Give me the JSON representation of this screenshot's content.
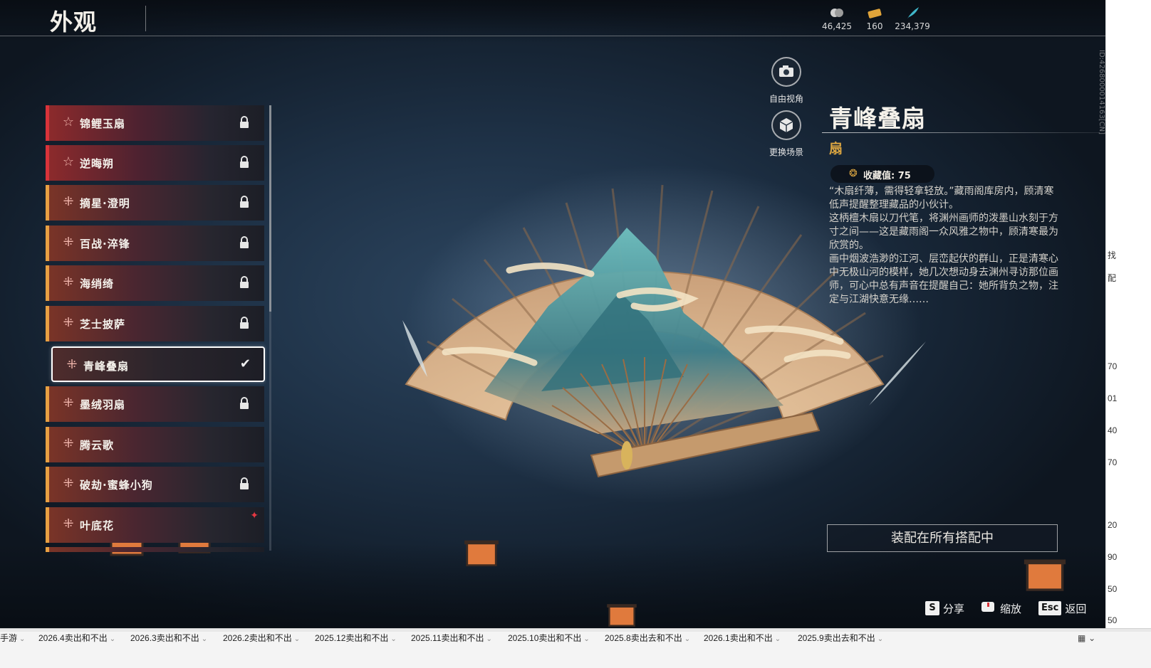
{
  "header": {
    "title": "外观",
    "currencies": [
      {
        "icon": "coin-icon",
        "value": "46,425"
      },
      {
        "icon": "ticket-icon",
        "value": "160"
      },
      {
        "icon": "feather-icon",
        "value": "234,379"
      }
    ]
  },
  "side_id": "ID:4268000014163[CN]",
  "list": {
    "items": [
      {
        "label": "锦鲤玉扇",
        "rarity": "red",
        "locked": true
      },
      {
        "label": "逆晦朔",
        "rarity": "red",
        "locked": true
      },
      {
        "label": "摘星·澄明",
        "rarity": "gold",
        "locked": true
      },
      {
        "label": "百战·淬锋",
        "rarity": "gold",
        "locked": true
      },
      {
        "label": "海绡绮",
        "rarity": "gold",
        "locked": true
      },
      {
        "label": "芝士披萨",
        "rarity": "gold",
        "locked": true
      },
      {
        "label": "青峰叠扇",
        "rarity": "gold",
        "locked": false,
        "selected": true
      },
      {
        "label": "墨绒羽扇",
        "rarity": "gold",
        "locked": true
      },
      {
        "label": "腾云歌",
        "rarity": "gold",
        "locked": false
      },
      {
        "label": "破劫·蜜蜂小狗",
        "rarity": "gold",
        "locked": true
      },
      {
        "label": "叶底花",
        "rarity": "gold",
        "locked": false,
        "new": true
      }
    ]
  },
  "controls": {
    "free_camera": "自由视角",
    "change_scene": "更换场景"
  },
  "info": {
    "name": "青峰叠扇",
    "type": "扇",
    "collect_label": "收藏值: 75",
    "description": [
      "“木扇纤薄，需得轻拿轻放。”藏雨阁库房内，顾清寒低声提醒整理藏品的小伙计。",
      "这柄檀木扇以刀代笔，将渊州画师的泼墨山水刻于方寸之间——这是藏雨阁一众风雅之物中，顾清寒最为欣赏的。",
      "画中烟波浩渺的江河、层峦起伏的群山，正是清寒心中无极山河的模样，她几次想动身去渊州寻访那位画师，可心中总有声音在提醒自己：她所背负之物，注定与江湖快意无缘……"
    ],
    "equip_button": "装配在所有搭配中"
  },
  "hints": [
    {
      "key": "S",
      "label": "分享"
    },
    {
      "key": "",
      "label": "缩放"
    },
    {
      "key": "Esc",
      "label": "返回"
    }
  ],
  "sheet_tabs": [
    "手游",
    "2026.4卖出和不出",
    "2026.3卖出和不出",
    "2026.2卖出和不出",
    "2025.12卖出和不出",
    "2025.11卖出和不出",
    "2025.10卖出和不出",
    "2025.8卖出去和不出",
    "2026.1卖出和不出",
    "2025.9卖出去和不出"
  ],
  "sheet_right_values": [
    "找",
    "配",
    "70",
    "01",
    "40",
    "70",
    "20",
    "90",
    "50",
    "50"
  ],
  "colors": {
    "gold_accent": "#e8a042",
    "red_accent": "#d9333a",
    "type_color": "#d9a441"
  }
}
